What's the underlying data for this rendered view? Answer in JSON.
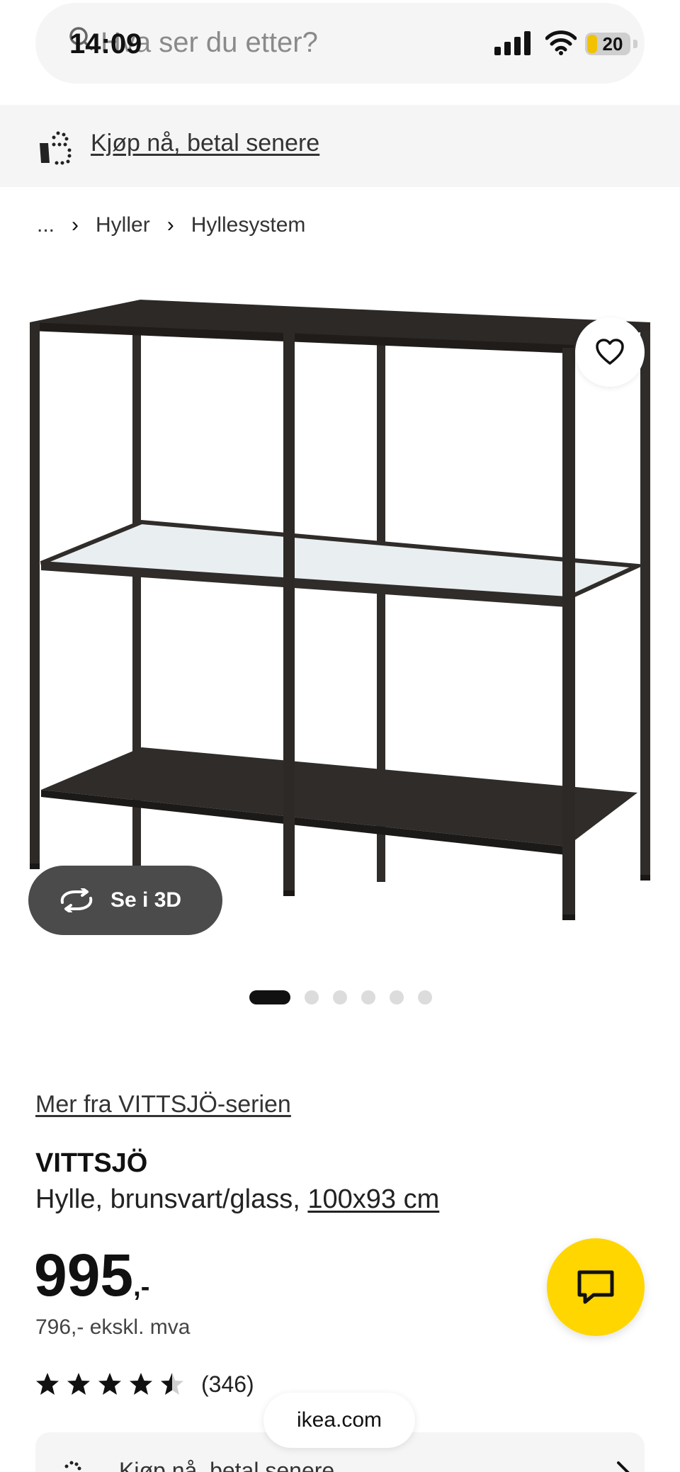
{
  "status_bar": {
    "time": "14:09",
    "battery_level": "20",
    "icons": [
      "signal-icon",
      "wifi-icon",
      "battery-icon"
    ]
  },
  "search": {
    "placeholder_visible": "Hva ser du etter?",
    "icon": "search-icon"
  },
  "promo_banner": {
    "text": "Kjøp nå, betal senere",
    "icon": "installment-bag-icon"
  },
  "breadcrumb": {
    "items": [
      "...",
      "Hyller",
      "Hyllesystem"
    ]
  },
  "gallery": {
    "view_3d_label": "Se i 3D",
    "image_count": 6,
    "active_index": 0
  },
  "product": {
    "series_link": "Mer fra VITTSJÖ-serien",
    "name": "VITTSJÖ",
    "description": "Hylle, brunsvart/glass, ",
    "size": "100x93 cm",
    "price_main": "995",
    "price_suffix": ",-",
    "price_ex_vat": "796,- ekskl. mva",
    "rating_value": 4.5,
    "rating_max": 5,
    "review_count": "(346)"
  },
  "bottom_card": {
    "text": "Kjøp nå, betal senere"
  },
  "browser": {
    "url": "ikea.com"
  },
  "colors": {
    "chat_fab": "#ffd600",
    "button_dark": "#4b4b4b",
    "banner_bg": "#f5f5f5"
  }
}
